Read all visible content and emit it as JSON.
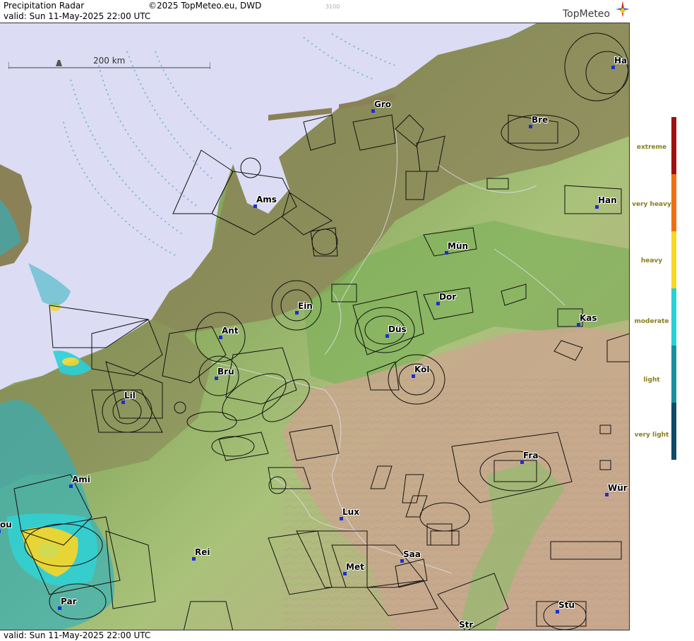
{
  "header": {
    "title": "Precipitation Radar",
    "copyright": "©2025 TopMeteo.eu, DWD",
    "small_code": "3100",
    "valid_top": "valid:  Sun  11-May-2025 22:00 UTC",
    "valid_bottom": "valid:  Sun  11-May-2025 22:00 UTC",
    "logo_text": "TopMeteo"
  },
  "scale": {
    "label": "200 km"
  },
  "cities": [
    {
      "id": "ha",
      "label": "Ha"
    },
    {
      "id": "gro",
      "label": "Gro"
    },
    {
      "id": "bre",
      "label": "Bre"
    },
    {
      "id": "ams",
      "label": "Ams"
    },
    {
      "id": "han",
      "label": "Han"
    },
    {
      "id": "mun",
      "label": "Mün"
    },
    {
      "id": "dor",
      "label": "Dor"
    },
    {
      "id": "ein",
      "label": "Ein"
    },
    {
      "id": "kas",
      "label": "Kas"
    },
    {
      "id": "ant",
      "label": "Ant"
    },
    {
      "id": "dus",
      "label": "Düs"
    },
    {
      "id": "bru",
      "label": "Bru"
    },
    {
      "id": "kol",
      "label": "Köl"
    },
    {
      "id": "lil",
      "label": "Lil"
    },
    {
      "id": "fra",
      "label": "Fra"
    },
    {
      "id": "ami",
      "label": "Ami"
    },
    {
      "id": "wur",
      "label": "Wür"
    },
    {
      "id": "lux",
      "label": "Lux"
    },
    {
      "id": "rei",
      "label": "Rei"
    },
    {
      "id": "saa",
      "label": "Saa"
    },
    {
      "id": "met",
      "label": "Met"
    },
    {
      "id": "par",
      "label": "Par"
    },
    {
      "id": "stu",
      "label": "Stu"
    },
    {
      "id": "str",
      "label": "Str"
    },
    {
      "id": "ou",
      "label": "ou"
    }
  ],
  "legend": {
    "items": [
      {
        "label": "extreme",
        "color": "#a01010"
      },
      {
        "label": "very heavy",
        "color": "#f07010"
      },
      {
        "label": "heavy",
        "color": "#f8d820"
      },
      {
        "label": "moderate",
        "color": "#28d0d8"
      },
      {
        "label": "light",
        "color": "#1890a0"
      },
      {
        "label": "very light",
        "color": "#104a68"
      }
    ]
  },
  "colors": {
    "sea": "#dcdcf4",
    "lowland": "#8a7f55",
    "plain": "#7fae5a",
    "hills": "#c8c08a",
    "mountains": "#c9a88e"
  }
}
